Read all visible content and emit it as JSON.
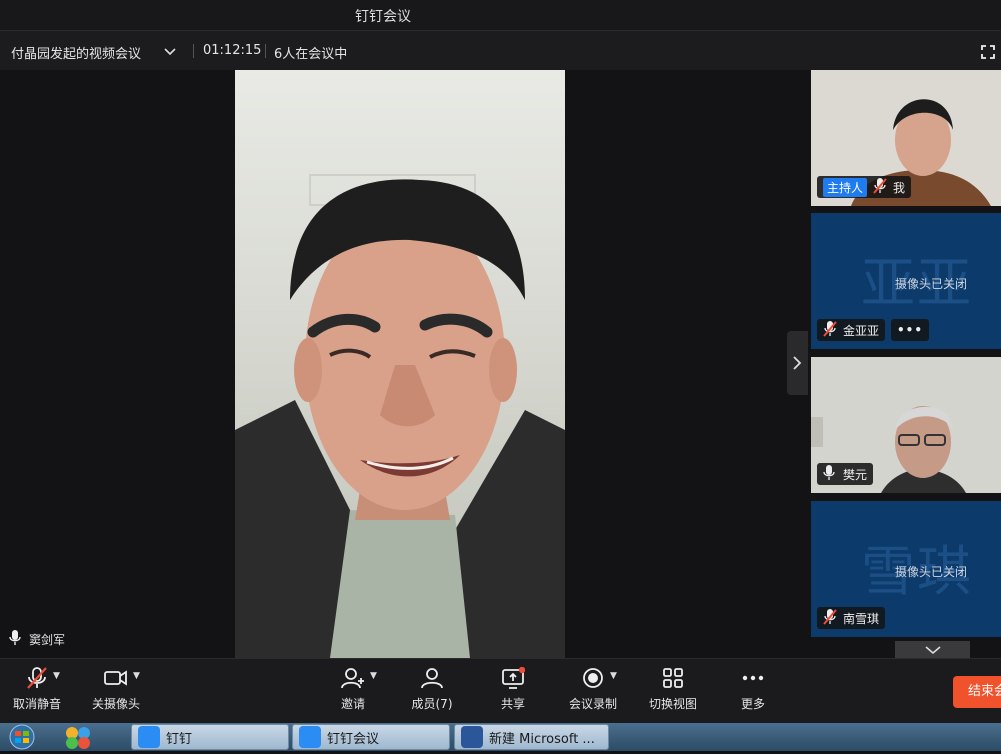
{
  "window": {
    "title": "钉钉会议"
  },
  "meeting": {
    "name": "付晶园发起的视频会议",
    "duration": "01:12:15",
    "participants_text": "6人在会议中"
  },
  "main_speaker": {
    "name": "窦剑军"
  },
  "sidebar": {
    "tiles": [
      {
        "name": "我",
        "badge": "主持人",
        "camera": "on",
        "mic": "muted"
      },
      {
        "name": "金亚亚",
        "camera_status": "摄像头已关闭",
        "watermark": "亚亚",
        "mic": "muted",
        "more": "•••"
      },
      {
        "name": "樊元",
        "camera": "on",
        "mic": "on"
      },
      {
        "name": "南雪琪",
        "camera_status": "摄像头已关闭",
        "watermark": "雪琪",
        "mic": "muted"
      }
    ]
  },
  "toolbar": {
    "unmute": "取消静音",
    "camera_off": "关摄像头",
    "invite": "邀请",
    "members": "成员(7)",
    "share": "共享",
    "record": "会议录制",
    "switch_view": "切换视图",
    "more": "更多",
    "end": "结束会议"
  },
  "taskbar": {
    "items": [
      "钉钉",
      "钉钉会议",
      "新建 Microsoft ..."
    ]
  },
  "colors": {
    "accent": "#1e7bf0",
    "end_button": "#f0522b",
    "camera_off_bg": "#0c3a6a"
  },
  "icons": [
    "chevron-down-icon",
    "fullscreen-icon",
    "microphone-icon",
    "microphone-muted-icon",
    "camera-icon",
    "add-user-icon",
    "members-icon",
    "share-screen-icon",
    "record-icon",
    "grid-view-icon",
    "more-icon",
    "chevron-right-icon"
  ]
}
